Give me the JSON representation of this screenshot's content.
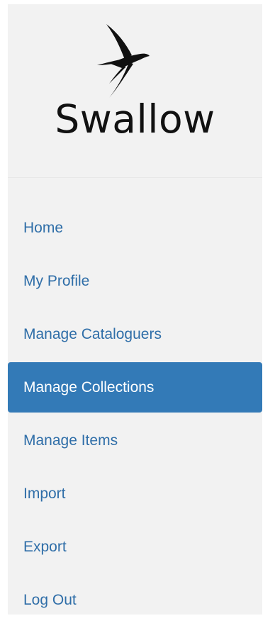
{
  "brand": {
    "name": "Swallow",
    "icon": "swallow-bird-icon"
  },
  "colors": {
    "sidebar_bg": "#f2f2f2",
    "link": "#2f6ea8",
    "active_bg": "#337ab7",
    "active_text": "#ffffff"
  },
  "nav": {
    "active_index": 3,
    "items": [
      {
        "label": "Home"
      },
      {
        "label": "My Profile"
      },
      {
        "label": "Manage Cataloguers"
      },
      {
        "label": "Manage Collections"
      },
      {
        "label": "Manage Items"
      },
      {
        "label": "Import"
      },
      {
        "label": "Export"
      },
      {
        "label": "Log Out"
      }
    ]
  }
}
